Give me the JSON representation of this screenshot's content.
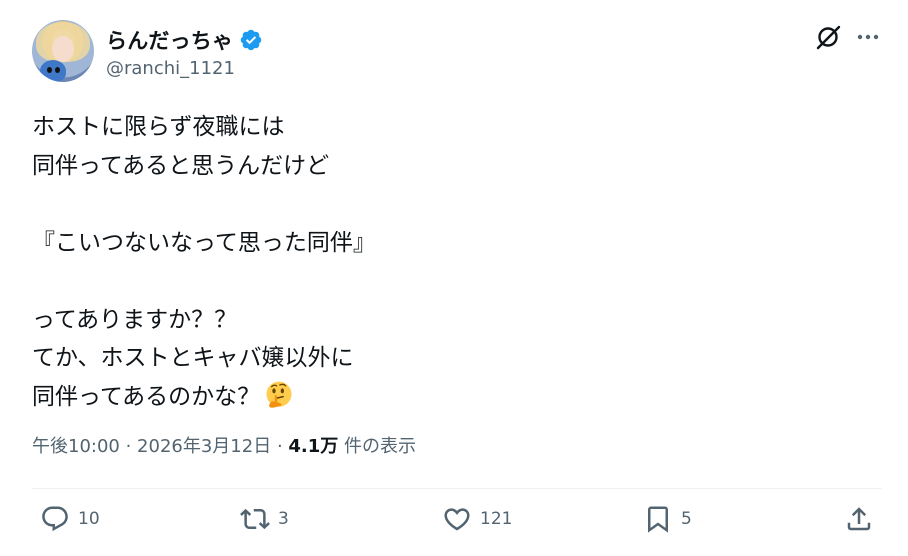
{
  "user": {
    "display_name": "らんだっちゃ",
    "handle": "@ranchi_1121",
    "verified_icon": "verified-badge-icon",
    "verified_color": "#1d9bf0"
  },
  "header_actions": {
    "grok_icon": "grok-icon",
    "more_icon": "more-icon"
  },
  "tweet": {
    "lines": [
      "ホストに限らず夜職には",
      "同伴ってあると思うんだけど",
      "",
      "『こいつないなって思った同伴』",
      "",
      "ってありますか？？",
      "てか、ホストとキャバ嬢以外に",
      "同伴ってあるのかな？"
    ],
    "emoji": "thinking-face-emoji"
  },
  "meta": {
    "time": "午後10:00",
    "separator": " · ",
    "date": "2026年3月12日",
    "views_count": "4.1万",
    "views_label": " 件の表示"
  },
  "actions": {
    "reply_count": "10",
    "repost_count": "3",
    "like_count": "121",
    "bookmark_count": "5"
  },
  "colors": {
    "text": "#0f1419",
    "secondary": "#536471",
    "divider": "#eff3f4"
  }
}
